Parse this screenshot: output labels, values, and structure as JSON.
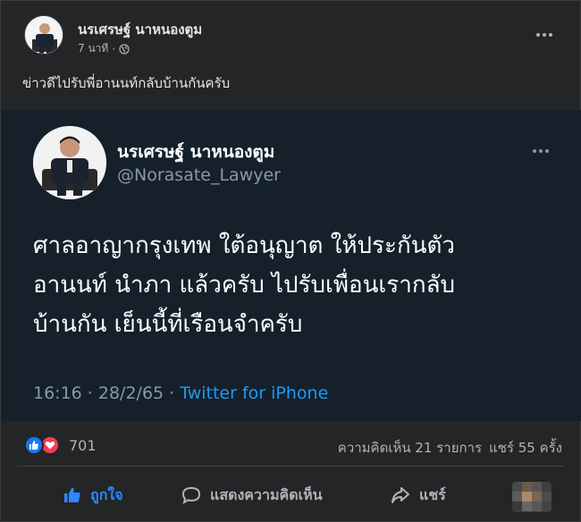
{
  "post": {
    "author": "นรเศรษฐ์ นาหนองตูม",
    "time": "7 นาที",
    "separator": "·",
    "text": "ข่าวดีไปรับพี่อานนท์กลับบ้านกันครับ"
  },
  "tweet": {
    "name": "นรเศรษฐ์ นาหนองตูม",
    "handle": "@Norasate_Lawyer",
    "body_lines": [
      "ศาลอาญากรุงเทพ ใต้อนุญาต ให้ประกันตัว",
      "อานนท์ นำภา แล้วครับ ไปรับเพื่อนเรากลับ",
      "บ้านกัน เย็นนี้ที่เรือนจำครับ"
    ],
    "timestamp": "16:16 · 28/2/65 · ",
    "source": "Twitter for iPhone"
  },
  "stats": {
    "reaction_count": "701",
    "comments": "ความคิดเห็น 21 รายการ",
    "shares": "แชร์ 55 ครั้ง"
  },
  "actions": {
    "like": "ถูกใจ",
    "comment": "แสดงความคิดเห็น",
    "share": "แชร์"
  },
  "colors": {
    "accent": "#2d88ff",
    "twitter_bg": "#15202b",
    "twitter_link": "#1d9bf0",
    "love": "#f33e58"
  }
}
